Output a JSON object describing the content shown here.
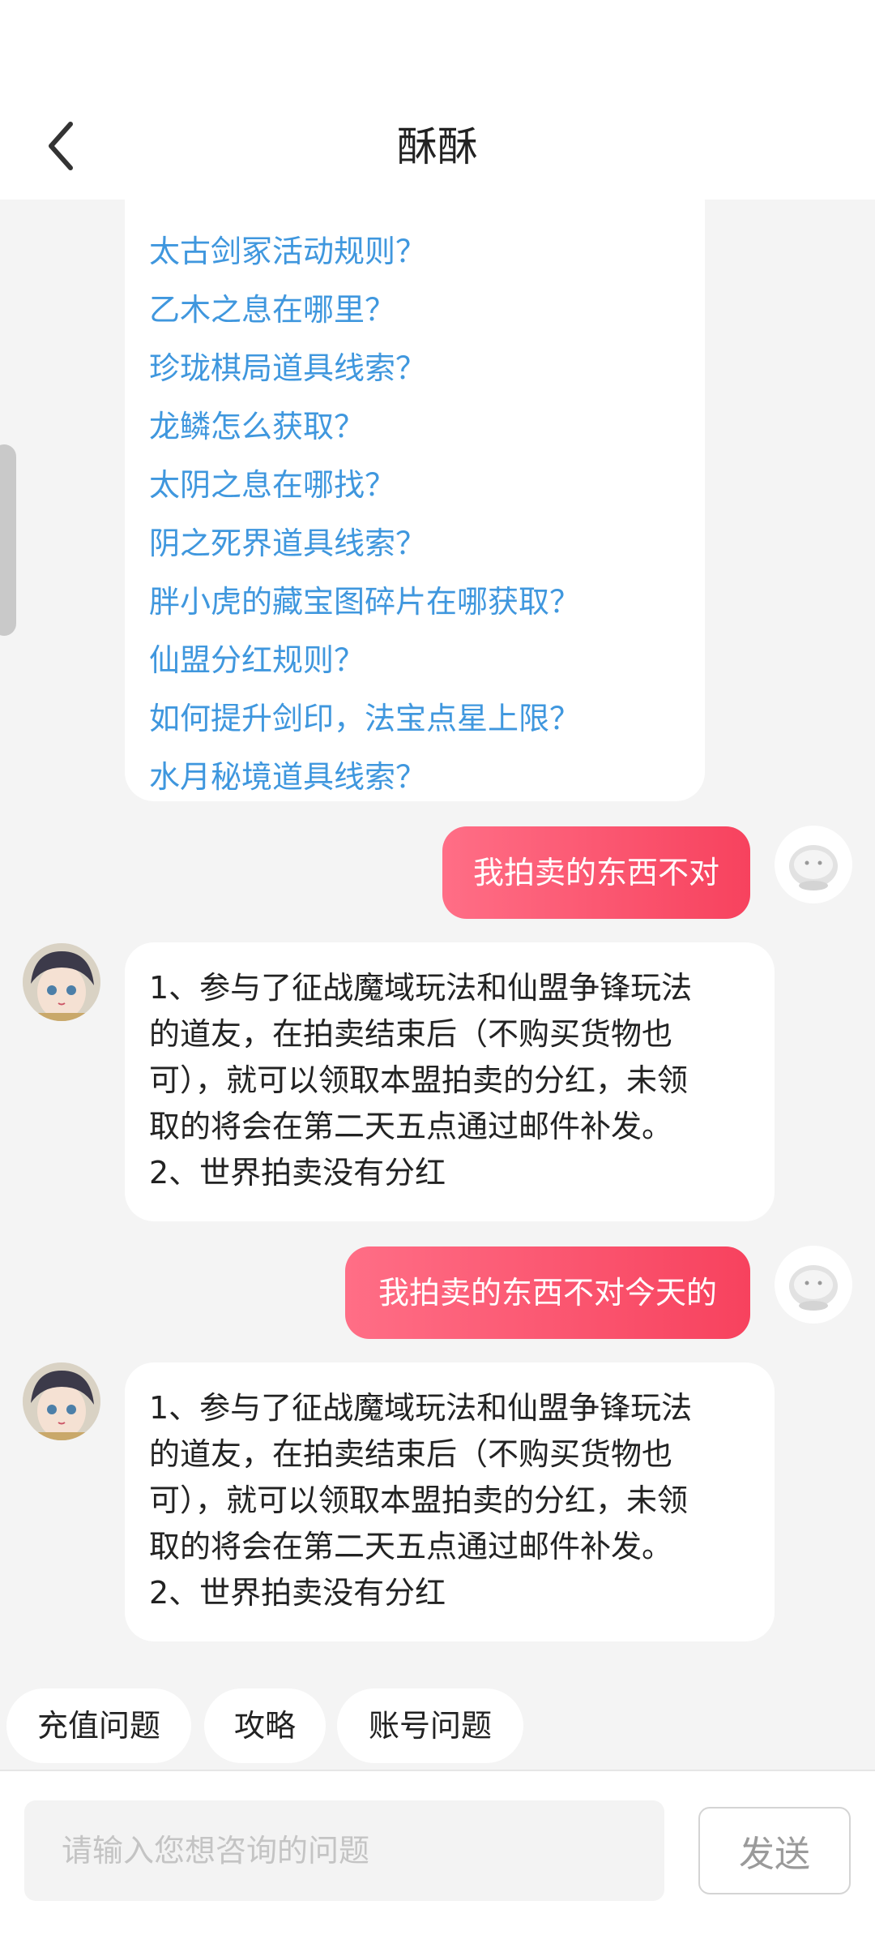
{
  "header": {
    "title": "酥酥"
  },
  "links": [
    "太古剑冢活动规则？",
    "乙木之息在哪里？",
    "珍珑棋局道具线索？",
    "龙鳞怎么获取？",
    "太阴之息在哪找？",
    "阴之死界道具线索？",
    "胖小虎的藏宝图碎片在哪获取？",
    "仙盟分红规则？",
    "如何提升剑印，法宝点星上限？",
    "水月秘境道具线索？"
  ],
  "messages": [
    {
      "text": "我拍卖的东西不对"
    },
    {
      "lines": [
        "1、参与了征战魔域玩法和仙盟争锋玩法",
        "的道友，在拍卖结束后（不购买货物也",
        "可），就可以领取本盟拍卖的分红，未领",
        "取的将会在第二天五点通过邮件补发。",
        "2、世界拍卖没有分红"
      ]
    },
    {
      "text": "我拍卖的东西不对今天的"
    },
    {
      "lines": [
        "1、参与了征战魔域玩法和仙盟争锋玩法",
        "的道友，在拍卖结束后（不购买货物也",
        "可），就可以领取本盟拍卖的分红，未领",
        "取的将会在第二天五点通过邮件补发。",
        "2、世界拍卖没有分红"
      ]
    }
  ],
  "quick_replies": [
    "充值问题",
    "攻略",
    "账号问题"
  ],
  "input": {
    "placeholder": "请输入您想咨询的问题",
    "value": ""
  },
  "send_label": "发送",
  "colors": {
    "accent_start": "#ff6e86",
    "accent_end": "#f7425e",
    "link": "#3f97de",
    "background": "#f4f4f4"
  }
}
